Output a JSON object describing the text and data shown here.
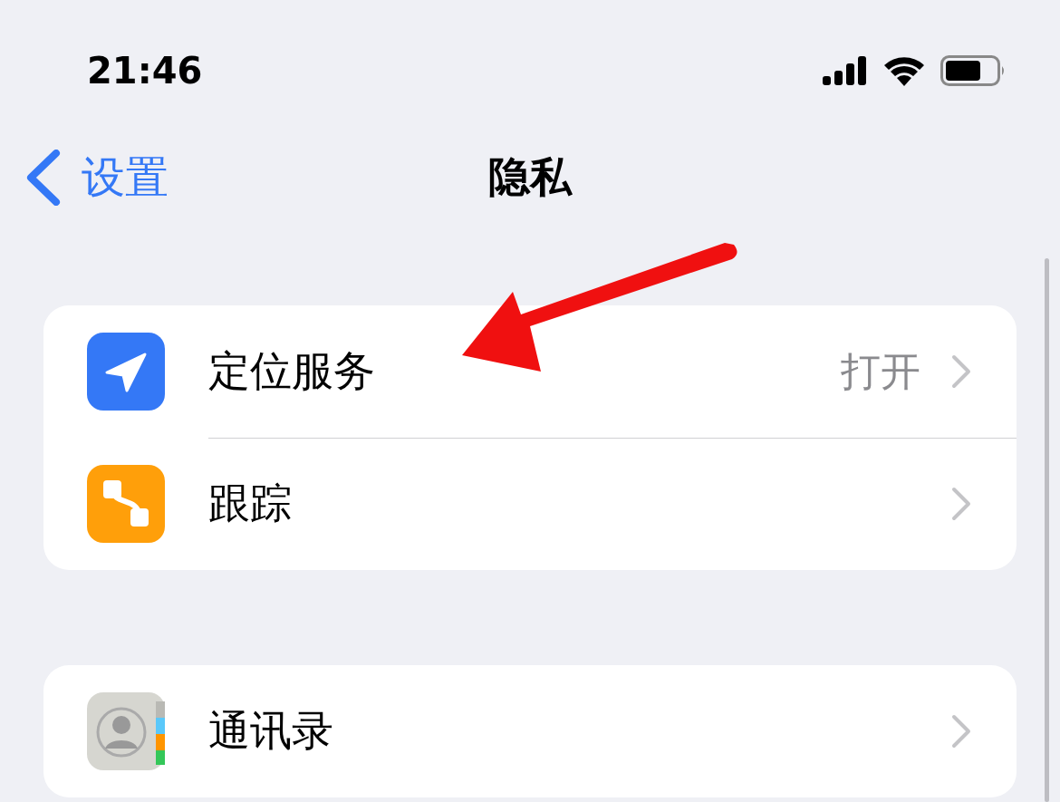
{
  "status_bar": {
    "time": "21:46"
  },
  "nav": {
    "back": "设置",
    "title": "隐私"
  },
  "groups": [
    {
      "rows": [
        {
          "label": "定位服务",
          "value": "打开"
        },
        {
          "label": "跟踪"
        }
      ]
    },
    {
      "rows": [
        {
          "label": "通讯录"
        }
      ]
    }
  ]
}
